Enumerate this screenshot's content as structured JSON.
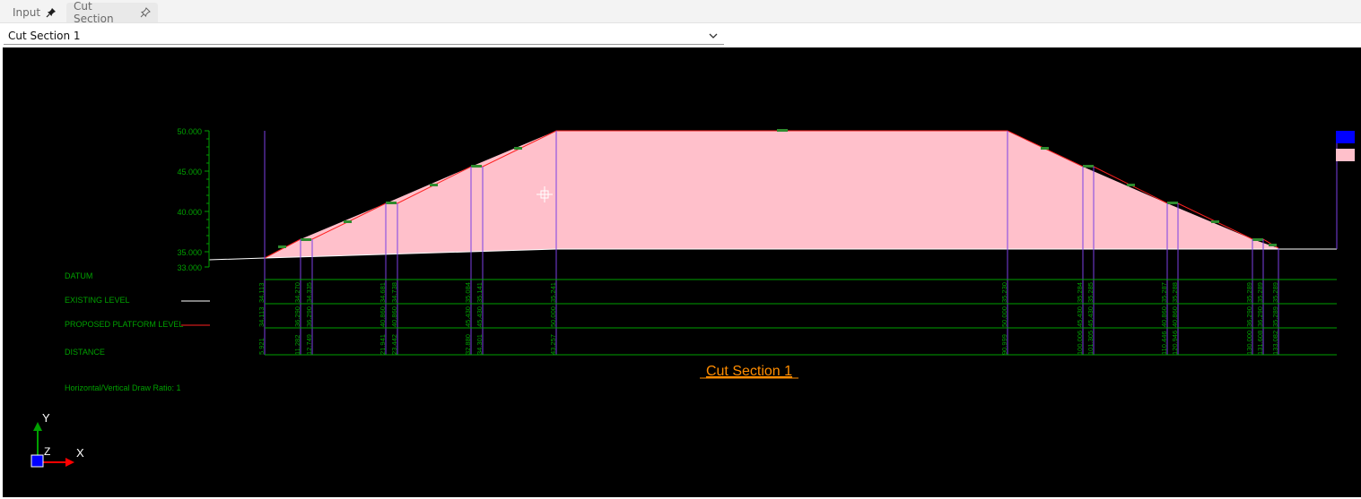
{
  "tabs": [
    {
      "label": "Input",
      "icon": "pin-filled-icon"
    },
    {
      "label": "Cut Section",
      "icon": "pin-outline-icon"
    }
  ],
  "section_select": {
    "value": "Cut Section 1",
    "icon": "chevron-down-icon"
  },
  "drawing": {
    "title": "Cut Section 1",
    "ratio_text": "Horizontal/Vertical Draw Ratio: 1",
    "axis_ticks": [
      "50.000",
      "45.000",
      "40.000",
      "35.000",
      "33.000"
    ],
    "rows": {
      "datum": "DATUM",
      "existing": "EXISTING LEVEL",
      "proposed": "PROPOSED PLATFORM LEVEL",
      "distance": "DISTANCE"
    },
    "ucs": {
      "y": "Y",
      "z": "Z",
      "x": "X"
    },
    "stations": [
      {
        "existing": "34.113",
        "proposed": "34.113",
        "distance": "5.921"
      },
      {
        "existing": "34.270",
        "proposed": "36.290",
        "distance": "11.282"
      },
      {
        "existing": "34.335",
        "proposed": "36.290",
        "distance": "12.749"
      },
      {
        "existing": "34.681",
        "proposed": "40.860",
        "distance": "21.941"
      },
      {
        "existing": "34.738",
        "proposed": "40.860",
        "distance": "23.442"
      },
      {
        "existing": "35.084",
        "proposed": "45.430",
        "distance": "32.880"
      },
      {
        "existing": "35.141",
        "proposed": "45.430",
        "distance": "34.301"
      },
      {
        "existing": "35.241",
        "proposed": "50.000",
        "distance": "43.257"
      },
      {
        "existing": "35.230",
        "proposed": "50.000",
        "distance": "90.999"
      },
      {
        "existing": "35.284",
        "proposed": "45.430",
        "distance": "100.006"
      },
      {
        "existing": "35.285",
        "proposed": "45.430",
        "distance": "101.305"
      },
      {
        "existing": "35.287",
        "proposed": "40.860",
        "distance": "110.446"
      },
      {
        "existing": "35.288",
        "proposed": "40.860",
        "distance": "120.946"
      },
      {
        "existing": "35.289",
        "proposed": "36.290",
        "distance": "130.000"
      },
      {
        "existing": "35.289",
        "proposed": "36.290",
        "distance": "131.608"
      },
      {
        "existing": "35.289",
        "proposed": "35.289",
        "distance": "133.082"
      }
    ],
    "colors": {
      "canvas": "#000000",
      "fill": "#ffc0cb",
      "proposed_line": "#ff2020",
      "grid_green": "#00a000",
      "station_line": "#7b3fe4",
      "title": "#ff8c00",
      "legend_blue": "#0000ff"
    }
  }
}
